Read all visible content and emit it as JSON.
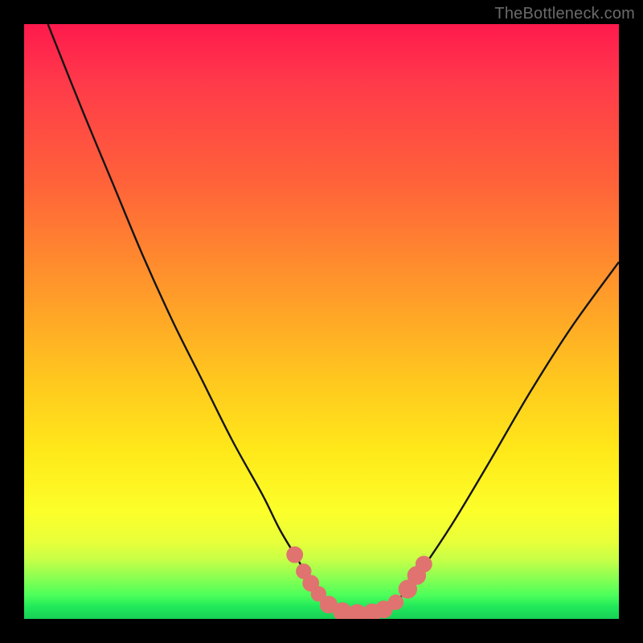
{
  "watermark": "TheBottleneck.com",
  "colors": {
    "background_frame": "#000000",
    "gradient_top": "#ff1a4d",
    "gradient_mid1": "#ff9a2a",
    "gradient_mid2": "#ffe91a",
    "gradient_bottom": "#18d056",
    "curve_stroke": "#141414",
    "marker_fill": "#e0736f",
    "watermark_text": "#6a6a6a"
  },
  "chart_data": {
    "type": "line",
    "title": "",
    "xlabel": "",
    "ylabel": "",
    "xlim": [
      0,
      100
    ],
    "ylim": [
      0,
      100
    ],
    "grid": false,
    "legend": false,
    "description": "Bottleneck-style V-curve: steep descent from top-left, flat trough around x≈50–60 near y≈0, then rising to the right edge near y≈60. Pink dot markers cluster near the trough and its shoulders.",
    "series": [
      {
        "name": "curve",
        "x": [
          4,
          10,
          15,
          20,
          25,
          30,
          35,
          40,
          43,
          46,
          48,
          50,
          52,
          54,
          56,
          58,
          60,
          62,
          64,
          67,
          72,
          78,
          85,
          92,
          100
        ],
        "y": [
          100,
          85,
          73,
          61,
          50,
          40,
          30,
          21,
          15,
          10,
          6.5,
          4,
          2.2,
          1.2,
          0.8,
          0.8,
          1.2,
          2.3,
          4.5,
          8.5,
          16,
          26,
          38,
          49,
          60
        ]
      }
    ],
    "markers": [
      {
        "x": 45.5,
        "y": 10.8,
        "r": 1.0
      },
      {
        "x": 47.0,
        "y": 8.0,
        "r": 0.9
      },
      {
        "x": 48.2,
        "y": 6.0,
        "r": 1.0
      },
      {
        "x": 49.5,
        "y": 4.2,
        "r": 0.9
      },
      {
        "x": 51.2,
        "y": 2.4,
        "r": 1.1
      },
      {
        "x": 53.5,
        "y": 1.2,
        "r": 1.2
      },
      {
        "x": 56.0,
        "y": 0.9,
        "r": 1.2
      },
      {
        "x": 58.5,
        "y": 1.0,
        "r": 1.2
      },
      {
        "x": 60.5,
        "y": 1.6,
        "r": 1.1
      },
      {
        "x": 62.5,
        "y": 2.8,
        "r": 0.9
      },
      {
        "x": 64.5,
        "y": 5.0,
        "r": 1.2
      },
      {
        "x": 66.0,
        "y": 7.3,
        "r": 1.2
      },
      {
        "x": 67.2,
        "y": 9.2,
        "r": 1.0
      }
    ]
  }
}
